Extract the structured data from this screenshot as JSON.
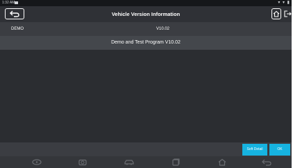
{
  "status_bar": {
    "time": "1:32 AM",
    "icons": "▾ ▾ ▮"
  },
  "titlebar": {
    "title": "Vehicle Version Information"
  },
  "info": {
    "name": "DEMO",
    "version": "V10.02"
  },
  "banner": {
    "text": "Demo and Test Program V10.02"
  },
  "actions": {
    "soft_detail": "Soft Detail",
    "ok": "OK"
  },
  "icons": {
    "back": "back-arrow-icon",
    "home": "home-icon",
    "exit": "exit-icon",
    "nav": [
      "car-connect-icon",
      "camera-icon",
      "vehicle-icon",
      "copy-icon",
      "home-icon",
      "back-icon"
    ]
  },
  "colors": {
    "accent": "#16b3e0",
    "background": "#3b3d42",
    "content": "#2b2d31",
    "titlebar": "#2f3136"
  }
}
